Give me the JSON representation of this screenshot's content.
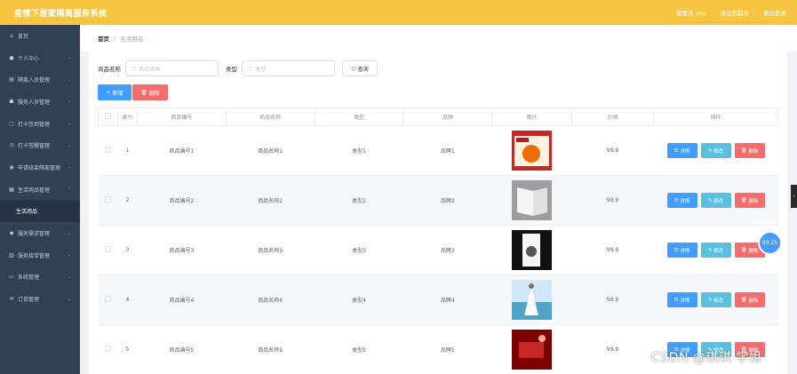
{
  "header": {
    "title": "疫情下居家隔离服务系统",
    "user": "管理员 abo",
    "back_home": "退出到前台",
    "logout": "退出登录"
  },
  "sidebar": {
    "items": [
      {
        "label": "首页",
        "icon": "home-icon"
      },
      {
        "label": "个人中心",
        "icon": "user-icon"
      },
      {
        "label": "隔离人员管理",
        "icon": "list-icon"
      },
      {
        "label": "服务人员管理",
        "icon": "team-icon"
      },
      {
        "label": "打卡签到管理",
        "icon": "doc-icon"
      },
      {
        "label": "打卡签醒管理",
        "icon": "clock-icon"
      },
      {
        "label": "申请结束隔离管理",
        "icon": "pin-icon"
      },
      {
        "label": "生活用品管理",
        "icon": "box-icon"
      },
      {
        "label": "生活用品",
        "icon": "",
        "sub": true
      },
      {
        "label": "服务需求管理",
        "icon": "location-icon"
      },
      {
        "label": "服务接单管理",
        "icon": "grid-icon"
      },
      {
        "label": "系统管理",
        "icon": "settings-icon"
      },
      {
        "label": "订单管理",
        "icon": "mail-icon"
      }
    ]
  },
  "breadcrumb": {
    "home": "首页",
    "sep": "/",
    "current": "生活用品"
  },
  "search": {
    "name_label": "商品名称",
    "name_placeholder": "商品名称",
    "type_label": "类型",
    "type_placeholder": "类型",
    "query_button": "查询"
  },
  "actions": {
    "add": "新增",
    "delete": "删除"
  },
  "table": {
    "headers": [
      "",
      "索引",
      "商品编号",
      "商品名称",
      "类型",
      "品牌",
      "图片",
      "价格",
      "操作"
    ],
    "row_buttons": {
      "detail": "详情",
      "edit": "修改",
      "delete": "删除"
    },
    "rows": [
      {
        "index": "1",
        "code": "商品编号1",
        "name": "商品名称1",
        "type": "类型1",
        "brand": "品牌1",
        "price": "99.9",
        "thumb": "food-packet"
      },
      {
        "index": "2",
        "code": "商品编号2",
        "name": "商品名称2",
        "type": "类型2",
        "brand": "品牌2",
        "price": "99.9",
        "thumb": "book"
      },
      {
        "index": "3",
        "code": "商品编号3",
        "name": "商品名称3",
        "type": "类型3",
        "brand": "品牌3",
        "price": "99.9",
        "thumb": "dark-box"
      },
      {
        "index": "4",
        "code": "商品编号4",
        "name": "商品名称4",
        "type": "类型4",
        "brand": "品牌4",
        "price": "99.9",
        "thumb": "dress"
      },
      {
        "index": "5",
        "code": "商品编号5",
        "name": "商品名称5",
        "type": "类型5",
        "brand": "品牌5",
        "price": "99.9",
        "thumb": "red-room"
      }
    ]
  },
  "timer": "03:25",
  "watermark": "CSDN @琪琪 学姐",
  "colors": {
    "header": "#f5c542",
    "sidebar": "#304156",
    "primary": "#409eff",
    "danger": "#f56c6c",
    "info": "#5bc0de"
  }
}
